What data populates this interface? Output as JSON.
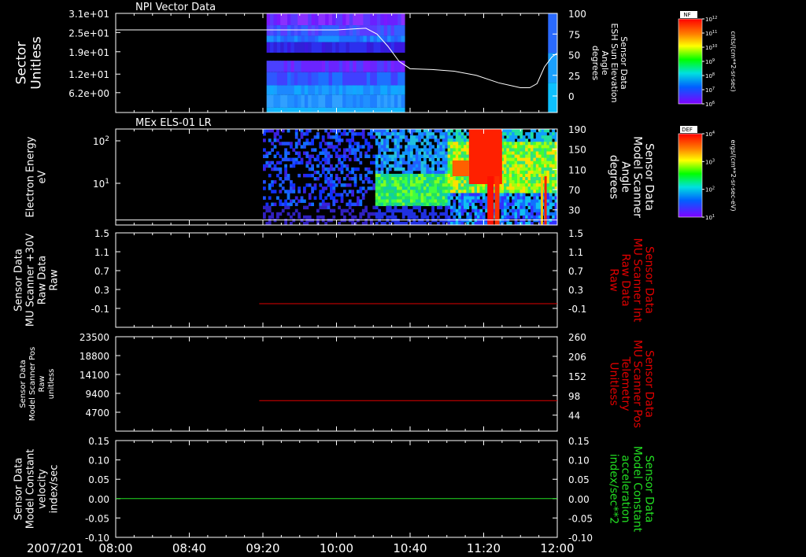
{
  "colors": {
    "background": "#000000",
    "axis": "#ffffff",
    "red": "#e00000",
    "green": "#22dd22"
  },
  "chart_data": [
    {
      "type": "heatmap",
      "title": "NPI Vector Data",
      "ylabel": [
        "Sector",
        "Unitless"
      ],
      "ytick_labels": [
        "3.1e+01",
        "2.5e+01",
        "1.9e+01",
        "1.2e+01",
        "6.2e+00"
      ],
      "ylim": [
        0,
        31
      ],
      "right_ylabel": [
        "Sensor Data",
        "ESH Sun Elevation",
        "Angle",
        "degrees"
      ],
      "right_ytick_labels": [
        "100",
        "75",
        "50",
        "25",
        "0"
      ],
      "right_ylim": [
        -20,
        100
      ],
      "colorbar": {
        "label": "NF",
        "units": "cnts/(cm**2-sr-sec)",
        "tick_labels": [
          "10^12",
          "10^11",
          "10^10",
          "10^9",
          "10^8",
          "10^7",
          "10^6"
        ]
      },
      "line": {
        "name": "ESH Sun Elevation Angle",
        "x": [
          "08:00",
          "08:40",
          "09:20",
          "10:00",
          "10:16",
          "10:22",
          "10:28",
          "10:34",
          "10:40",
          "10:52",
          "11:04",
          "11:16",
          "11:28",
          "11:40",
          "11:45",
          "11:49",
          "11:53",
          "11:57",
          "12:00"
        ],
        "y": [
          80,
          80,
          80,
          80,
          82,
          75,
          60,
          42,
          33,
          32,
          30,
          25,
          16,
          10,
          10,
          15,
          35,
          47,
          52
        ]
      },
      "data_intervals": [
        [
          "09:22",
          "10:37"
        ],
        [
          "11:55",
          "12:00"
        ]
      ]
    },
    {
      "type": "heatmap",
      "title": "MEx ELS-01 LR",
      "ylabel": [
        "Electron Energy",
        "eV"
      ],
      "yscale": "log",
      "ytick_labels": [
        "10^2",
        "10^1"
      ],
      "right_ylabel": [
        "Sensor Data",
        "Model Scanner",
        "Angle",
        "degrees"
      ],
      "right_ytick_labels": [
        "190",
        "150",
        "110",
        "70",
        "30"
      ],
      "right_ylim": [
        0,
        190
      ],
      "colorbar": {
        "label": "DEF",
        "units": "ergs/(cm**2-sr-sec-eV)",
        "tick_labels": [
          "10^4",
          "10^3",
          "10^2",
          "10^1"
        ]
      },
      "line": {
        "name": "Model Scanner Angle",
        "x": [
          "08:00",
          "12:00"
        ],
        "y": [
          10,
          10
        ]
      },
      "data_intervals": [
        [
          "09:20",
          "12:00"
        ]
      ]
    },
    {
      "type": "line",
      "ylabel": [
        "Sensor Data",
        "MU Scanner +30V",
        "Raw Data",
        "Raw"
      ],
      "ytick_labels": [
        "1.5",
        "1.1",
        "0.7",
        "0.3",
        "-0.1"
      ],
      "ylim": [
        -0.5,
        1.5
      ],
      "right_ylabel": [
        "Sensor Data",
        "MU Scanner Int",
        "Raw Data",
        "Raw"
      ],
      "right_ytick_labels": [
        "1.5",
        "1.1",
        "0.7",
        "0.3",
        "-0.1"
      ],
      "series": [
        {
          "x": [
            "09:18",
            "12:00"
          ],
          "y": [
            0.0,
            0.0
          ]
        }
      ]
    },
    {
      "type": "line",
      "ylabel": [
        "Sensor Data",
        "Model Scanner Pos",
        "Raw",
        "unitless"
      ],
      "ytick_labels": [
        "23500",
        "18800",
        "14100",
        "9400",
        "4700"
      ],
      "ylim": [
        0,
        23500
      ],
      "right_ylabel": [
        "Sensor Data",
        "MU Scanner Pos",
        "Telemetry",
        "Unitless"
      ],
      "right_ytick_labels": [
        "260",
        "206",
        "152",
        "98",
        "44"
      ],
      "right_ylim": [
        0,
        260
      ],
      "series": [
        {
          "x": [
            "09:18",
            "12:00"
          ],
          "y": [
            84,
            84
          ]
        }
      ]
    },
    {
      "type": "line",
      "ylabel": [
        "Sensor Data",
        "Model Constant",
        "velocity",
        "index/sec"
      ],
      "ytick_labels": [
        "0.15",
        "0.10",
        "0.05",
        "0.00",
        "-0.05",
        "-0.10"
      ],
      "ylim": [
        -0.1,
        0.15
      ],
      "right_ylabel": [
        "Sensor Data",
        "Model Constant",
        "acceleration",
        "index/sec**2"
      ],
      "right_ytick_labels": [
        "0.15",
        "0.10",
        "0.05",
        "0.00",
        "-0.05",
        "-0.10"
      ],
      "series": [
        {
          "x": [
            "08:00",
            "12:00"
          ],
          "y": [
            0.0,
            0.0
          ]
        }
      ]
    }
  ],
  "x_axis": {
    "date_label": "2007/201",
    "tick_labels": [
      "08:00",
      "08:40",
      "09:20",
      "10:00",
      "10:40",
      "11:20",
      "12:00"
    ],
    "range": [
      "08:00",
      "12:00"
    ]
  }
}
